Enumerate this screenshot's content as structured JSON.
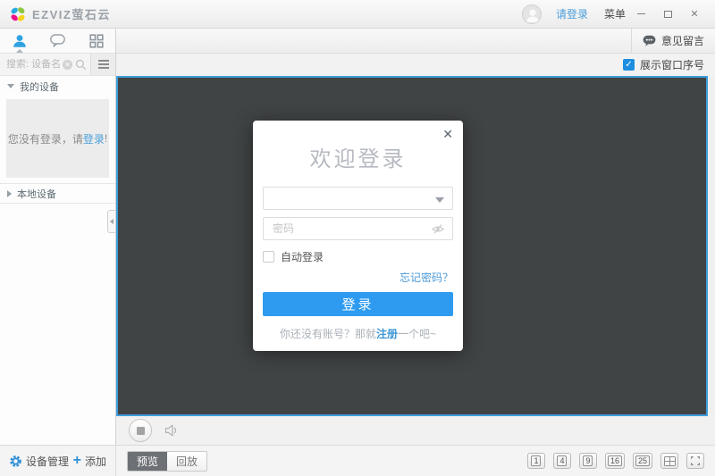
{
  "titlebar": {
    "logo_text": "EZVIZ萤石云",
    "login_link": "请登录",
    "menu_label": "菜单"
  },
  "sidebar": {
    "search_placeholder": "搜索: 设备名",
    "my_devices_label": "我的设备",
    "login_notice": {
      "prefix": "您没有登录，请",
      "link": "登录",
      "suffix": "!"
    },
    "local_devices_label": "本地设备"
  },
  "toolbar": {
    "feedback_label": "意见留言",
    "show_window_number_label": "展示窗口序号",
    "show_window_number_checked": true,
    "checkmark": "✓"
  },
  "login_dialog": {
    "title": "欢迎登录",
    "username_value": "",
    "password_placeholder": "密码",
    "auto_login_label": "自动登录",
    "auto_login_checked": false,
    "forgot_password_link": "忘记密码？",
    "login_button_label": "登录",
    "register_hint": {
      "prefix": "你还没有账号？那就",
      "link": "注册",
      "suffix": "一个吧~"
    },
    "close_glyph": "✕"
  },
  "bottombar": {
    "device_management_label": "设备管理",
    "add_label": "添加",
    "add_glyph": "+",
    "preview_tab": "预览",
    "playback_tab": "回放",
    "active_tab": "预览",
    "layout_buttons": [
      "1",
      "4",
      "9",
      "16",
      "25"
    ]
  },
  "window_controls": {
    "close_glyph": "✕"
  },
  "icons": {
    "ezviz-logo-icon": "four-petal-flower",
    "avatar": "person-silhouette",
    "minimize-icon": "horizontal-bar",
    "maximize-icon": "square-outline",
    "close-icon": "✕",
    "contacts-tab-icon": "person",
    "messages-tab-icon": "speech-bubble",
    "devices-tab-icon": "grid-2x2",
    "clear-search-icon": "circled-x",
    "search-icon": "magnifier",
    "list-view-icon": "hamburger-lines",
    "collapse-sidebar-icon": "left-arrow-tab",
    "feedback-icon": "speech-bubble-dots",
    "dropdown-arrow-icon": "down-triangle",
    "password-eye-icon": "eye-slash",
    "stop-icon": "square-in-circle",
    "volume-icon": "speaker",
    "gear-icon": "gear",
    "add-icon": "plus",
    "custom-layout-icon": "split-grid",
    "fullscreen-icon": "expand-corners"
  },
  "colors": {
    "accent_blue": "#2e9bf0",
    "link_blue": "#4a9fd8",
    "checkbox_blue": "#1e8fe0",
    "active_tab_blue": "#2fa3e2",
    "video_background": "#414445",
    "video_border": "#3f9ddc",
    "logo_blue": "#29abe2",
    "logo_green": "#8dc63f",
    "logo_magenta": "#ec0f8c",
    "logo_yellow": "#f5d415"
  }
}
